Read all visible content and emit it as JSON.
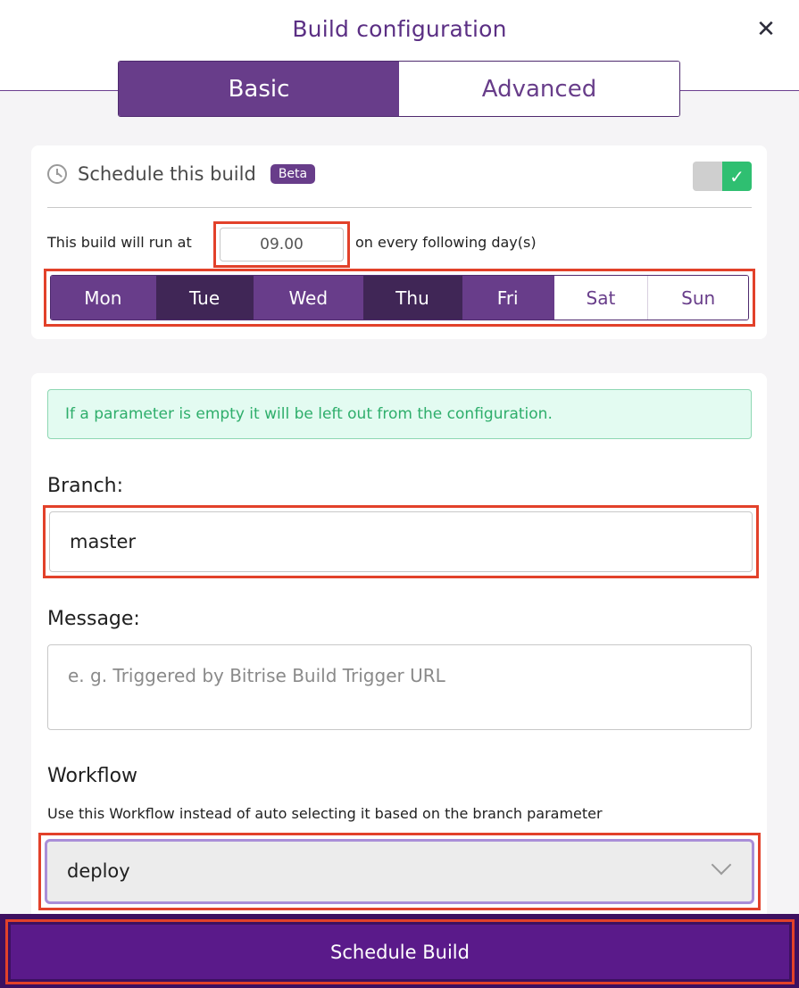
{
  "header": {
    "title": "Build configuration",
    "close_icon": "close-icon"
  },
  "tabs": [
    {
      "label": "Basic",
      "active": true
    },
    {
      "label": "Advanced",
      "active": false
    }
  ],
  "schedule": {
    "label": "Schedule this build",
    "badge": "Beta",
    "icon": "clock-icon",
    "enabled": true,
    "run_at_prefix": "This build will run at",
    "time": "09.00",
    "run_at_suffix": "on every following day(s)",
    "days": [
      {
        "label": "Mon",
        "selected": true
      },
      {
        "label": "Tue",
        "selected": true
      },
      {
        "label": "Wed",
        "selected": true
      },
      {
        "label": "Thu",
        "selected": true
      },
      {
        "label": "Fri",
        "selected": true
      },
      {
        "label": "Sat",
        "selected": false
      },
      {
        "label": "Sun",
        "selected": false
      }
    ]
  },
  "params": {
    "notice": "If a parameter is empty it will be left out from the configuration.",
    "branch_label": "Branch:",
    "branch_value": "master",
    "message_label": "Message:",
    "message_placeholder": "e. g. Triggered by Bitrise Build Trigger URL",
    "workflow_label": "Workflow",
    "workflow_desc": "Use this Workflow instead of auto selecting it based on the branch parameter",
    "workflow_value": "deploy"
  },
  "footer": {
    "schedule_button": "Schedule Build"
  },
  "colors": {
    "brand_purple": "#683d8a",
    "dark_purple": "#402656",
    "success_green": "#2fbf71",
    "highlight_red": "#e2412a",
    "button_purple": "#5a1a8a"
  }
}
